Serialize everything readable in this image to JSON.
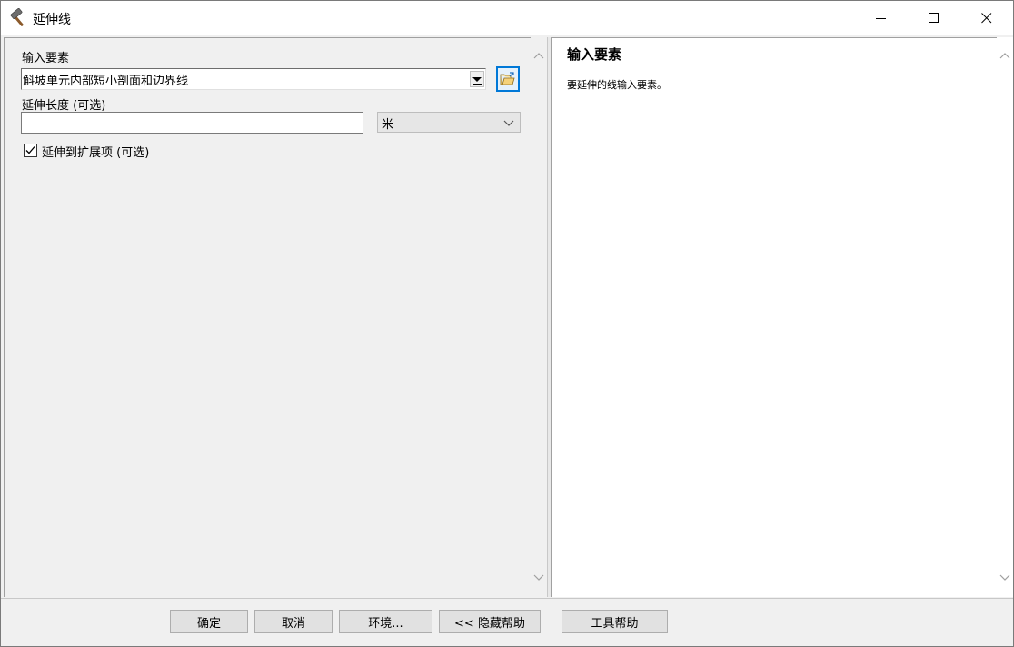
{
  "window": {
    "title": "延伸线",
    "icon": "hammer-icon",
    "controls": [
      "minimize-icon",
      "maximize-icon",
      "close-icon"
    ]
  },
  "form": {
    "input_features_label": "输入要素",
    "input_features_value": "斛坡单元内部短小剖面和边界线",
    "extend_length_label": "延伸长度 (可选)",
    "extend_length_value": "",
    "unit_value": "米",
    "extend_to_extensions_label": "延伸到扩展项 (可选)",
    "extend_to_extensions_checked": true
  },
  "help": {
    "title": "输入要素",
    "description": "要延伸的线输入要素。"
  },
  "buttons": {
    "ok": "确定",
    "cancel": "取消",
    "environments": "环境...",
    "hide_help": "<< 隐藏帮助",
    "tool_help": "工具帮助"
  },
  "colors": {
    "accent": "#0078d7",
    "window_bg": "#f0f0f0",
    "help_bg": "#ffffff"
  }
}
